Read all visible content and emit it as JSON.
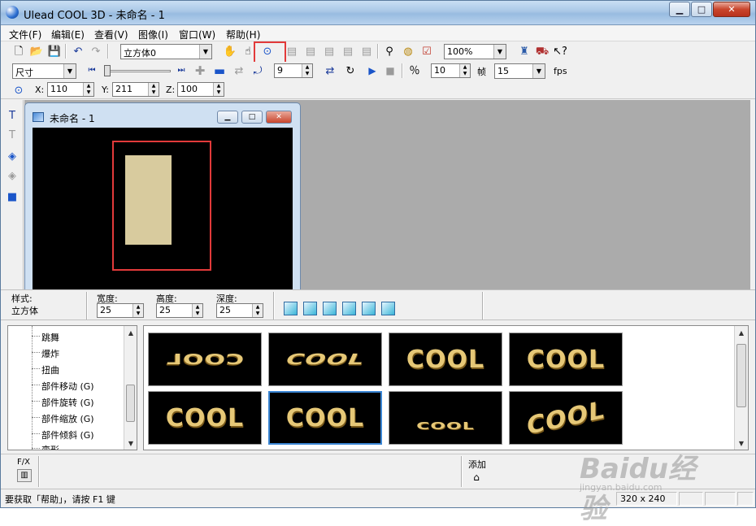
{
  "window": {
    "title": "Ulead COOL 3D - 未命名 - 1"
  },
  "menu": [
    "文件(F)",
    "编辑(E)",
    "查看(V)",
    "图像(I)",
    "窗口(W)",
    "帮助(H)"
  ],
  "toolbar1": {
    "object_combo": "立方体0",
    "zoom_combo": "100%"
  },
  "toolbar2": {
    "attr_combo": "尺寸",
    "frame_value": "9",
    "frames_total": "10",
    "frame_label": "帧",
    "fps_value": "15",
    "fps_label": "fps"
  },
  "toolbar3": {
    "x_label": "X:",
    "x_value": "110",
    "y_label": "Y:",
    "y_value": "211",
    "z_label": "Z:",
    "z_value": "100"
  },
  "document": {
    "title": "未命名 - 1"
  },
  "attributes": {
    "style_label": "样式:",
    "style_value": "立方体",
    "width_label": "宽度:",
    "width_value": "25",
    "height_label": "高度:",
    "height_value": "25",
    "depth_label": "深度:",
    "depth_value": "25"
  },
  "tree_items": [
    "跳舞",
    "爆炸",
    "扭曲",
    "部件移动 (G)",
    "部件旋转 (G)",
    "部件缩放 (G)",
    "部件倾斜 (G)",
    "变形"
  ],
  "gallery": [
    {
      "text": "COOL",
      "style": "flip-down"
    },
    {
      "text": "COOL",
      "style": "tumble"
    },
    {
      "text": "COOL",
      "style": "rotate-o"
    },
    {
      "text": "COOL",
      "style": "spin-o"
    },
    {
      "text": "COOL",
      "style": "plain"
    },
    {
      "text": "COOL",
      "style": "plain-selected"
    },
    {
      "text": "COOL",
      "style": "squash"
    },
    {
      "text": "COOL",
      "style": "fly-off"
    }
  ],
  "fx": {
    "label": "F/X",
    "add_label": "添加"
  },
  "status": {
    "help": "要获取「帮助」，请按 F1 键",
    "size": "320 x 240"
  },
  "watermark": {
    "main": "Baidu经验",
    "sub": "jingyan.baidu.com"
  }
}
